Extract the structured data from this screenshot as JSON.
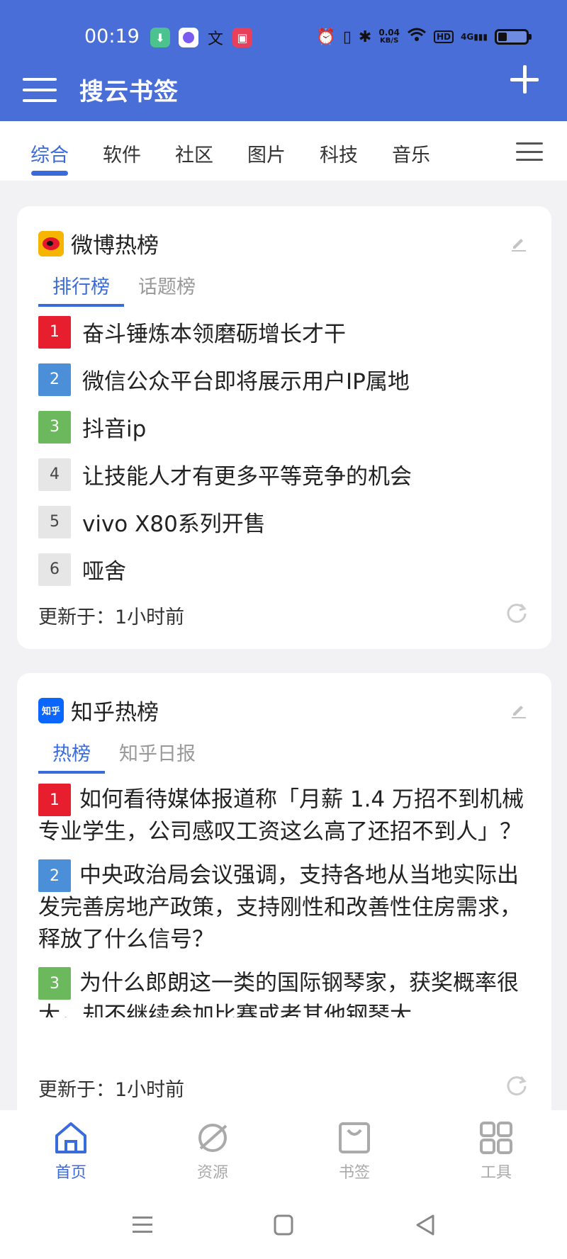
{
  "status_bar": {
    "time": "00:19",
    "net_speed_value": "0.04",
    "net_speed_unit": "KB/S",
    "hd": "HD",
    "signal": "4G",
    "battery_level": 0.3
  },
  "header": {
    "title": "搜云书签",
    "menu_icon": "hamburger-icon",
    "add_icon": "plus-icon",
    "background_color": "#4a6ed8"
  },
  "tabs": [
    {
      "label": "综合",
      "active": true
    },
    {
      "label": "软件"
    },
    {
      "label": "社区"
    },
    {
      "label": "图片"
    },
    {
      "label": "科技"
    },
    {
      "label": "音乐"
    }
  ],
  "accent_color": "#3a6bdc",
  "weibo": {
    "title": "微博热榜",
    "subtabs": [
      "排行榜",
      "话题榜"
    ],
    "items": [
      {
        "rank": "1",
        "text": "奋斗锤炼本领磨砺增长才干"
      },
      {
        "rank": "2",
        "text": "微信公众平台即将展示用户IP属地"
      },
      {
        "rank": "3",
        "text": "抖音ip"
      },
      {
        "rank": "4",
        "text": "让技能人才有更多平等竞争的机会"
      },
      {
        "rank": "5",
        "text": "vivo X80系列开售"
      },
      {
        "rank": "6",
        "text": "哑舍"
      }
    ],
    "updated": "更新于：1小时前"
  },
  "zhihu": {
    "title": "知乎热榜",
    "logo_text": "知乎",
    "subtabs": [
      "热榜",
      "知乎日报"
    ],
    "items": [
      {
        "rank": "1",
        "text": "如何看待媒体报道称「月薪 1.4 万招不到机械专业学生，公司感叹工资这么高了还招不到人」？"
      },
      {
        "rank": "2",
        "text": "中央政治局会议强调，支持各地从当地实际出发完善房地产政策，支持刚性和改善性住房需求，释放了什么信号？"
      },
      {
        "rank": "3",
        "text": "为什么郎朗这一类的国际钢琴家，获奖概率很大，却不继续参加比赛或者其他钢琴大"
      }
    ],
    "updated": "更新于：1小时前"
  },
  "bottom_nav": [
    {
      "label": "首页",
      "icon": "home-icon",
      "active": true
    },
    {
      "label": "资源",
      "icon": "planet-icon"
    },
    {
      "label": "书签",
      "icon": "bag-icon"
    },
    {
      "label": "工具",
      "icon": "grid-icon"
    }
  ]
}
